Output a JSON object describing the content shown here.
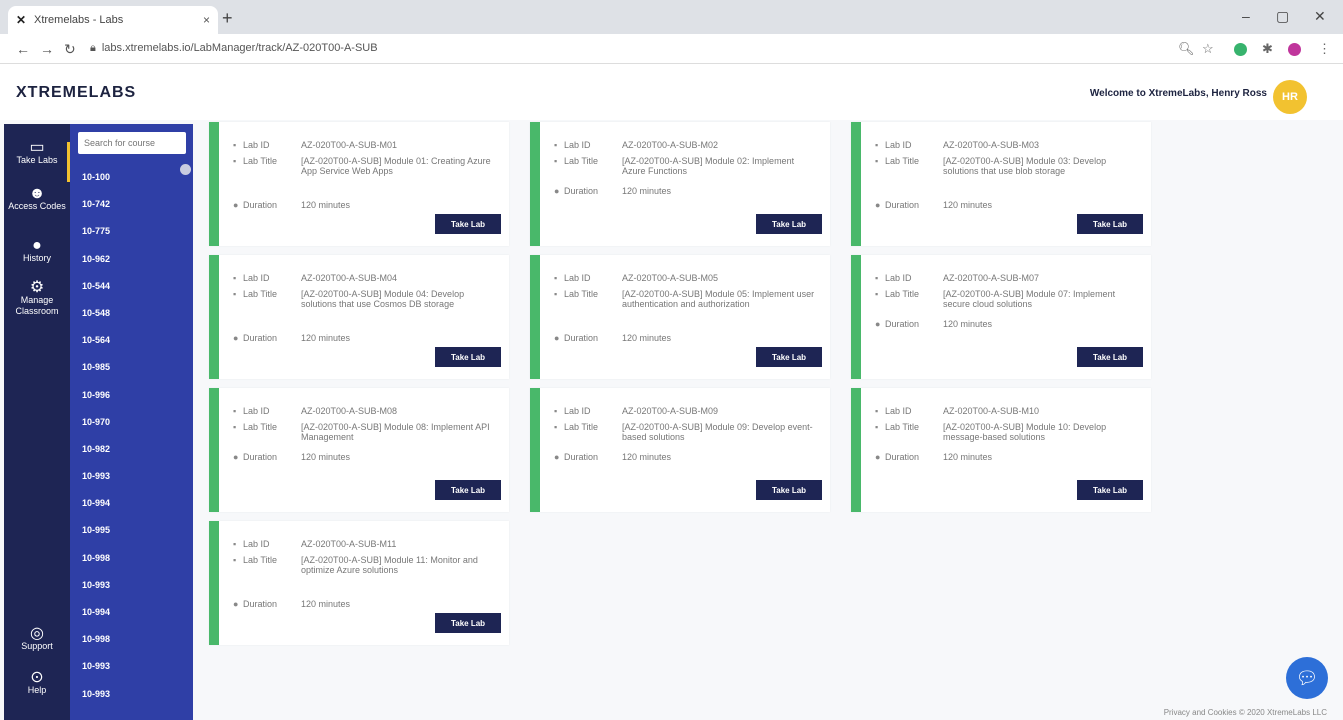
{
  "browser": {
    "tab_title": "Xtremelabs - Labs",
    "url": "labs.xtremelabs.io/LabManager/track/AZ-020T00-A-SUB",
    "ext_colors": [
      "#37b36d",
      "#c0359c"
    ]
  },
  "header": {
    "logo": "XTREMELABS",
    "welcome": "Welcome to XtremeLabs, Henry Ross",
    "avatar": "HR"
  },
  "rail": {
    "items": [
      {
        "label": "Take Labs",
        "icon": "monitor-icon"
      },
      {
        "label": "Access Codes",
        "icon": "users-icon"
      },
      {
        "label": "History",
        "icon": "history-icon"
      },
      {
        "label": "Manage Classroom",
        "icon": "gear-icon"
      },
      {
        "label": "Support",
        "icon": "support-icon"
      },
      {
        "label": "Help",
        "icon": "help-icon"
      }
    ]
  },
  "courses": {
    "search_placeholder": "Search for course",
    "items": [
      "10-100",
      "10-742",
      "10-775",
      "10-962",
      "10-544",
      "10-548",
      "10-564",
      "10-985",
      "10-996",
      "10-970",
      "10-982",
      "10-993",
      "10-994",
      "10-995",
      "10-998",
      "10-993",
      "10-994",
      "10-998",
      "10-993",
      "10-993"
    ]
  },
  "card_labels": {
    "lab_id": "Lab ID",
    "lab_title": "Lab Title",
    "duration": "Duration",
    "button": "Take Lab"
  },
  "cards": [
    {
      "id": "AZ-020T00-A-SUB-M01",
      "title": "[AZ-020T00-A-SUB] Module 01: Creating Azure App Service Web Apps",
      "duration": "120 minutes"
    },
    {
      "id": "AZ-020T00-A-SUB-M02",
      "title": "[AZ-020T00-A-SUB] Module 02: Implement Azure Functions",
      "duration": "120 minutes"
    },
    {
      "id": "AZ-020T00-A-SUB-M03",
      "title": "[AZ-020T00-A-SUB] Module 03: Develop solutions that use blob storage",
      "duration": "120 minutes"
    },
    {
      "id": "AZ-020T00-A-SUB-M04",
      "title": "[AZ-020T00-A-SUB] Module 04: Develop solutions that use Cosmos DB storage",
      "duration": "120 minutes"
    },
    {
      "id": "AZ-020T00-A-SUB-M05",
      "title": "[AZ-020T00-A-SUB] Module 05: Implement user authentication and authorization",
      "duration": "120 minutes"
    },
    {
      "id": "AZ-020T00-A-SUB-M07",
      "title": "[AZ-020T00-A-SUB] Module 07: Implement secure cloud solutions",
      "duration": "120 minutes"
    },
    {
      "id": "AZ-020T00-A-SUB-M08",
      "title": "[AZ-020T00-A-SUB] Module 08: Implement API Management",
      "duration": "120 minutes"
    },
    {
      "id": "AZ-020T00-A-SUB-M09",
      "title": "[AZ-020T00-A-SUB] Module 09: Develop event-based solutions",
      "duration": "120 minutes"
    },
    {
      "id": "AZ-020T00-A-SUB-M10",
      "title": "[AZ-020T00-A-SUB] Module 10: Develop message-based solutions",
      "duration": "120 minutes"
    },
    {
      "id": "AZ-020T00-A-SUB-M11",
      "title": "[AZ-020T00-A-SUB] Module 11: Monitor and optimize Azure solutions",
      "duration": "120 minutes"
    }
  ],
  "footer": "Privacy and Cookies  © 2020 XtremeLabs LLC"
}
